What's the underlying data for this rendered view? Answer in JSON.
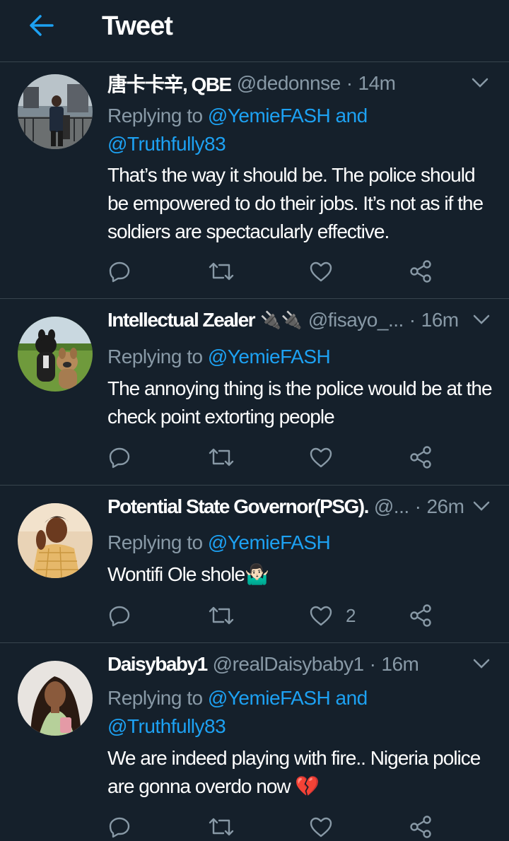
{
  "header": {
    "title": "Tweet"
  },
  "tweets": [
    {
      "name": "唐卡卡辛, QBE",
      "handle": "@dedonnse",
      "time": "14m",
      "replying_prefix": "Replying to ",
      "replying_to": "@YemieFASH and",
      "replying_to_2": "@Truthfully83",
      "body": "That’s the way it should be. The police should be empowered to do their jobs. It’s not as if the soldiers are spectacularly effective.",
      "likes": ""
    },
    {
      "name": "Intellectual Zealer",
      "name_emoji": "🔌🔌",
      "handle": "@fisayo_...",
      "time": "16m",
      "replying_prefix": "Replying to ",
      "replying_to": "@YemieFASH",
      "body": "The annoying thing is the police would be at the check point extorting people",
      "likes": ""
    },
    {
      "name": "Potential State Governor(PSG).",
      "handle": "@...",
      "time": "26m",
      "replying_prefix": "Replying to ",
      "replying_to": "@YemieFASH",
      "body": "Wontifi Ole shole🤷🏻‍♂️",
      "likes": "2"
    },
    {
      "name": "Daisybaby1",
      "handle": "@realDaisybaby1",
      "time": "16m",
      "replying_prefix": "Replying to ",
      "replying_to": "@YemieFASH and",
      "replying_to_2": "@Truthfully83",
      "body": "We are indeed playing with fire.. Nigeria police are gonna overdo now 💔",
      "likes": ""
    }
  ],
  "separator": "·",
  "colors": {
    "background": "#15202b",
    "accent": "#1da1f2",
    "muted": "#8899a6",
    "divider": "#38444d"
  },
  "icons": [
    "back-arrow-icon",
    "chevron-down-icon",
    "reply-icon",
    "retweet-icon",
    "like-icon",
    "share-icon"
  ]
}
